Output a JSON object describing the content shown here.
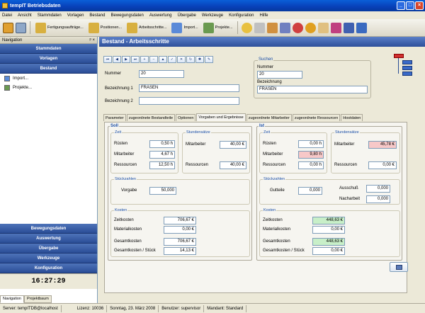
{
  "window": {
    "title": "tempIT Betriebsdaten"
  },
  "menu": [
    "Datei",
    "Ansicht",
    "Stammdaten",
    "Vorlagen",
    "Bestand",
    "Bewegungsdaten",
    "Auswertung",
    "Übergabe",
    "Werkzeuge",
    "Konfiguration",
    "Hilfe"
  ],
  "toolbar": {
    "fertigung": "Fertigungsaufträge...",
    "positionen": "Positionen...",
    "arbeitsschritte": "Arbeitsschritte...",
    "import": "Import...",
    "projekte": "Projekte..."
  },
  "nav": {
    "header": "Navigation",
    "pin": "ᵖ ×",
    "top_buttons": [
      "Stammdaten",
      "Vorlagen",
      "Bestand"
    ],
    "items": [
      "Import...",
      "Projekte..."
    ],
    "bottom_buttons": [
      "Bewegungsdaten",
      "Auswertung",
      "Übergabe",
      "Werkzeuge",
      "Konfiguration"
    ],
    "clock": "16:27:29",
    "tabs": [
      "Navigation",
      "Projektbaum"
    ]
  },
  "main": {
    "title": "Bestand - Arbeitsschritte"
  },
  "record_nav": [
    "⏮",
    "◀",
    "▶",
    "⏭",
    "+",
    "−",
    "▲",
    "✓",
    "✕",
    "↻",
    "✱",
    "✎"
  ],
  "form": {
    "nummer_label": "Nummer",
    "nummer": "20",
    "bez1_label": "Bezeichnung 1",
    "bez1": "FRÄSEN",
    "bez2_label": "Bezeichnung 2",
    "bez2": ""
  },
  "suchen": {
    "title": "Suchen",
    "nummer_label": "Nummer",
    "nummer": "20",
    "bez_label": "Bezeichnung",
    "bez": "FRÄSEN"
  },
  "tabs": [
    "Parameter",
    "zugeordnete Bestandteile",
    "Optionen",
    "Vorgaben und Ergebnisse",
    "zugeordnete Mitarbeiter",
    "zugeordnete Ressourcen",
    "Hostdaten"
  ],
  "soll": {
    "title": "Soll",
    "zeit": {
      "title": "Zeit",
      "ruesten_label": "Rüsten",
      "ruesten": "0,50 h",
      "mitarbeiter_label": "Mitarbeiter",
      "mitarbeiter": "4,67 h",
      "ressourcen_label": "Ressourcen",
      "ressourcen": "12,50 h"
    },
    "saetze": {
      "title": "Stundensätze",
      "mitarbeiter_label": "Mitarbeiter",
      "mitarbeiter": "40,00 €",
      "ressourcen_label": "Ressourcen",
      "ressourcen": "40,00 €"
    },
    "stueck": {
      "title": "Stückzahlen",
      "vorgabe_label": "Vorgabe",
      "vorgabe": "50,000"
    },
    "kosten": {
      "title": "Kosten",
      "zeit_label": "Zeitkosten",
      "zeit": "706,67 €",
      "material_label": "Materialkosten",
      "material": "0,00 €",
      "gesamt_label": "Gesamtkosten",
      "gesamt": "706,67 €",
      "stueck_label": "Gesamtkosten / Stück",
      "stueck": "14,13 €"
    }
  },
  "ist": {
    "title": "Ist",
    "zeit": {
      "title": "Zeit",
      "ruesten_label": "Rüsten",
      "ruesten": "0,00 h",
      "mitarbeiter_label": "Mitarbeiter",
      "mitarbeiter": "9,80 h",
      "ressourcen_label": "Ressourcen",
      "ressourcen": "0,00 h"
    },
    "saetze": {
      "title": "Stundensätze",
      "mitarbeiter_label": "Mitarbeiter",
      "mitarbeiter": "45,78 €",
      "ressourcen_label": "Ressourcen",
      "ressourcen": "0,00 €"
    },
    "stueck": {
      "title": "Stückzahlen",
      "gutteile_label": "Gutteile",
      "gutteile": "0,000",
      "ausschuss_label": "Ausschuß",
      "ausschuss": "0,000",
      "nacharbeit_label": "Nacharbeit",
      "nacharbeit": "0,000"
    },
    "kosten": {
      "title": "Kosten",
      "zeit_label": "Zeitkosten",
      "zeit": "448,63 €",
      "material_label": "Materialkosten",
      "material": "0,00 €",
      "gesamt_label": "Gesamtkosten",
      "gesamt": "448,63 €",
      "stueck_label": "Gesamtkosten / Stück",
      "stueck": "0,00 €"
    }
  },
  "status": {
    "server": "Server: tempITDB@localhost",
    "lizenz": "Lizenz: 10036",
    "datum": "Sonntag, 23. März 2008",
    "benutzer": "Benutzer: supervisor",
    "mandant": "Mandant: Standard"
  }
}
